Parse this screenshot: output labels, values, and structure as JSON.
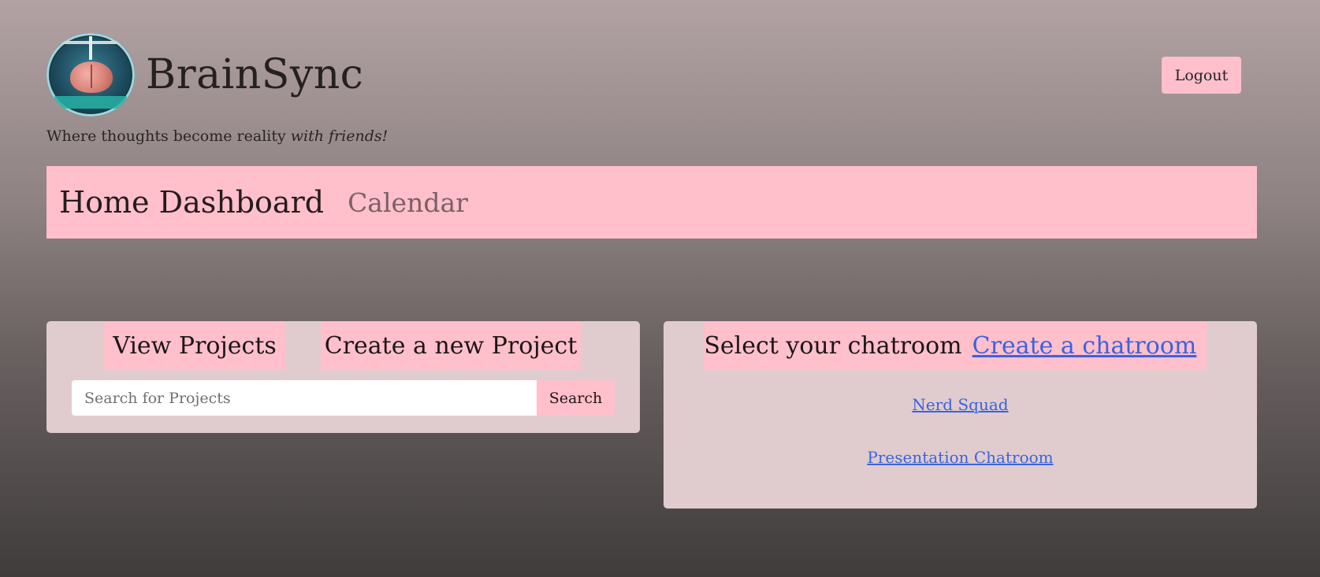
{
  "brand": {
    "name": "BrainSync",
    "tagline_prefix": "Where thoughts become reality ",
    "tagline_emphasis": "with friends!"
  },
  "header": {
    "logout_label": "Logout"
  },
  "nav": {
    "home_label": "Home Dashboard",
    "calendar_label": "Calendar"
  },
  "projects": {
    "view_label": "View Projects",
    "create_label": "Create a new Project",
    "search_placeholder": "Search for Projects",
    "search_value": "",
    "search_button_label": "Search"
  },
  "chat": {
    "select_label": "Select your chatroom",
    "create_label": "Create a chatroom",
    "rooms": [
      {
        "name": "Nerd Squad"
      },
      {
        "name": "Presentation Chatroom"
      }
    ]
  },
  "colors": {
    "accent_pink": "#ffbfcb",
    "panel_bg": "#e0ccce",
    "link_blue": "#3a63e0"
  }
}
